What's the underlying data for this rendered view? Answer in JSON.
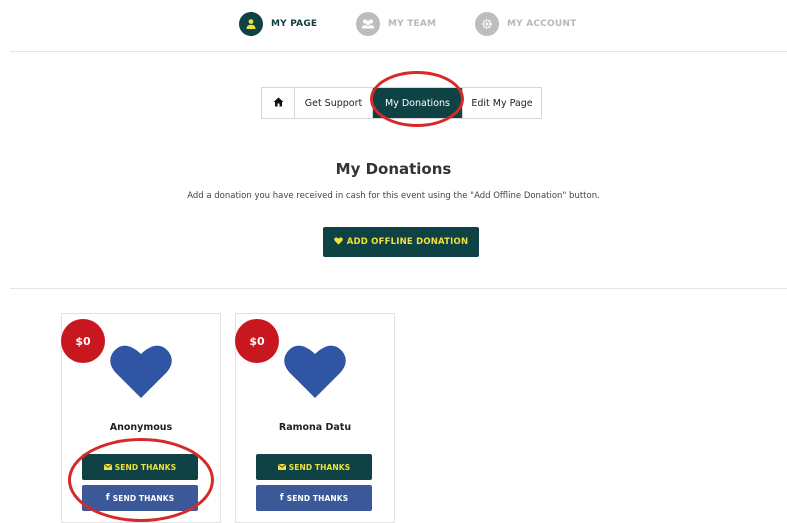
{
  "topnav": {
    "items": [
      {
        "label": "MY PAGE",
        "icon": "user-icon",
        "active": true
      },
      {
        "label": "MY TEAM",
        "icon": "team-icon",
        "active": false
      },
      {
        "label": "MY ACCOUNT",
        "icon": "gear-icon",
        "active": false
      }
    ]
  },
  "tabs": {
    "home_icon": "home-icon",
    "items": [
      "Get Support",
      "My Donations",
      "Edit My Page"
    ],
    "active": "My Donations"
  },
  "main": {
    "title": "My Donations",
    "subtitle": "Add a donation you have received in cash for this event using the \"Add Offline Donation\" button.",
    "add_button": "ADD OFFLINE DONATION"
  },
  "donations": [
    {
      "amount": "$0",
      "name": "Anonymous",
      "email_thanks": "SEND THANKS",
      "fb_thanks": "SEND THANKS"
    },
    {
      "amount": "$0",
      "name": "Ramona Datu",
      "email_thanks": "SEND THANKS",
      "fb_thanks": "SEND THANKS"
    }
  ],
  "colors": {
    "primary": "#0e4244",
    "accent_text": "#f2e03a",
    "badge": "#c8171e",
    "heart": "#2f55a4",
    "facebook": "#3b5998",
    "annotation": "#d62a2a"
  }
}
